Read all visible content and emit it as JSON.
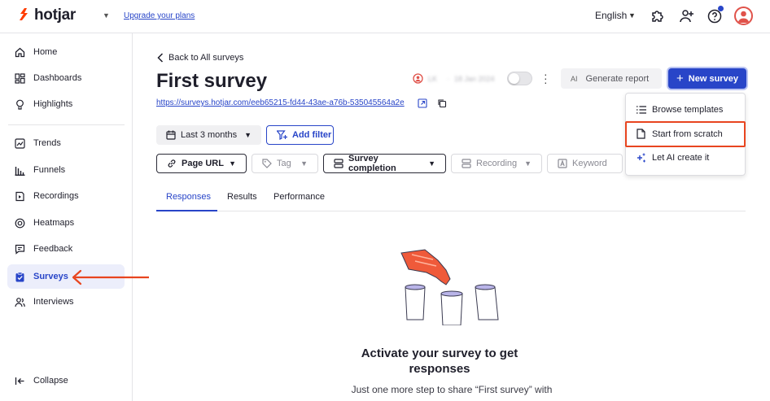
{
  "header": {
    "brand": "hotjar",
    "upgrade_link": "Upgrade your plans",
    "language": "English",
    "brand_color": "#ff3c00",
    "accent_color": "#2845c8"
  },
  "sidebar": {
    "items": [
      {
        "label": "Home",
        "icon": "home-icon"
      },
      {
        "label": "Dashboards",
        "icon": "dashboards-icon"
      },
      {
        "label": "Highlights",
        "icon": "highlights-icon"
      },
      {
        "label": "Trends",
        "icon": "trends-icon"
      },
      {
        "label": "Funnels",
        "icon": "funnels-icon"
      },
      {
        "label": "Recordings",
        "icon": "recordings-icon"
      },
      {
        "label": "Heatmaps",
        "icon": "heatmaps-icon"
      },
      {
        "label": "Feedback",
        "icon": "feedback-icon"
      },
      {
        "label": "Surveys",
        "icon": "surveys-icon",
        "active": true
      },
      {
        "label": "Interviews",
        "icon": "interviews-icon"
      }
    ],
    "collapse_label": "Collapse"
  },
  "main": {
    "back_label": "Back to All surveys",
    "title": "First survey",
    "survey_url": "https://surveys.hotjar.com/eeb65215-fd44-43ae-a76b-535045564a2e",
    "meta_author": "LK",
    "meta_date": "18 Jan 2024",
    "generate_report": {
      "ai_badge": "AI",
      "label": "Generate report"
    },
    "new_survey_label": "New survey",
    "dropdown": {
      "items": [
        {
          "label": "Browse templates",
          "icon": "list-icon"
        },
        {
          "label": "Start from scratch",
          "icon": "document-icon"
        },
        {
          "label": "Let AI create it",
          "icon": "ai-sparkle-icon"
        }
      ]
    },
    "filters": {
      "date_range": "Last 3 months",
      "add_filter": "Add filter",
      "chips": [
        {
          "label": "Page URL",
          "icon": "link-icon"
        },
        {
          "label": "Tag",
          "icon": "tag-icon"
        },
        {
          "label": "Survey completion",
          "icon": "survey-completion-icon"
        },
        {
          "label": "Recording",
          "icon": "recording-icon"
        },
        {
          "label": "Keyword",
          "icon": "keyword-icon"
        }
      ]
    },
    "tabs": [
      {
        "label": "Responses",
        "active": true
      },
      {
        "label": "Results"
      },
      {
        "label": "Performance"
      }
    ],
    "empty_state": {
      "title": "Activate your survey to get responses",
      "subtitle": "Just one more step to share “First survey” with"
    }
  }
}
